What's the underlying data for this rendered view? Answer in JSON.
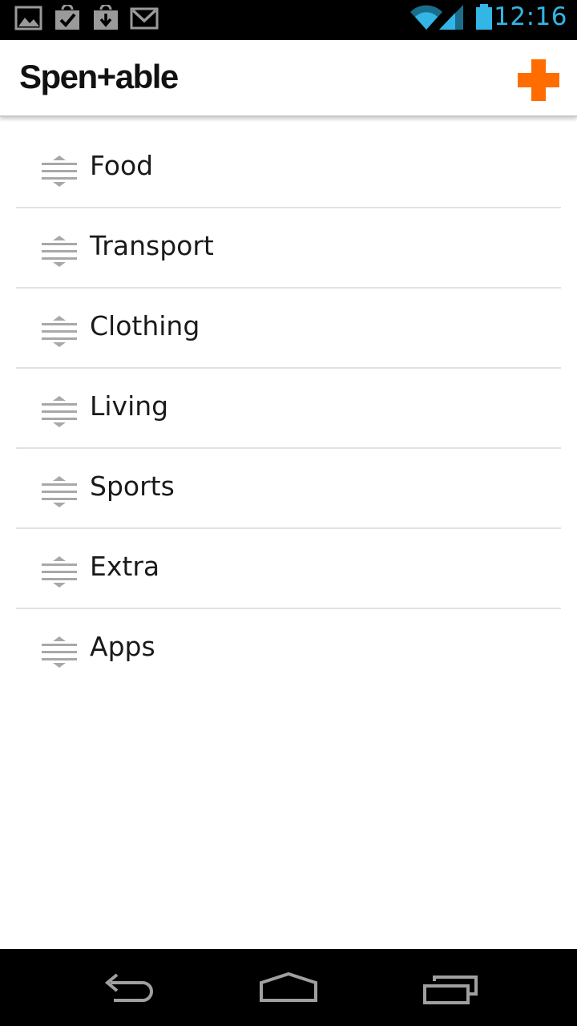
{
  "status_bar": {
    "time": "12:16",
    "icons": [
      "gallery-icon",
      "task-check-icon",
      "download-icon",
      "gmail-icon",
      "wifi-icon",
      "signal-icon",
      "battery-icon"
    ]
  },
  "action_bar": {
    "app_name": "Spen+able",
    "add_icon": "plus-icon"
  },
  "categories": [
    {
      "label": "Food"
    },
    {
      "label": "Transport"
    },
    {
      "label": "Clothing"
    },
    {
      "label": "Living"
    },
    {
      "label": "Sports"
    },
    {
      "label": "Extra"
    },
    {
      "label": "Apps"
    }
  ],
  "nav_bar": {
    "buttons": [
      "back-icon",
      "home-icon",
      "recents-icon"
    ]
  },
  "colors": {
    "accent_orange": "#ff6d00",
    "status_time_blue": "#33b5e5",
    "divider": "#e2e2e2"
  }
}
